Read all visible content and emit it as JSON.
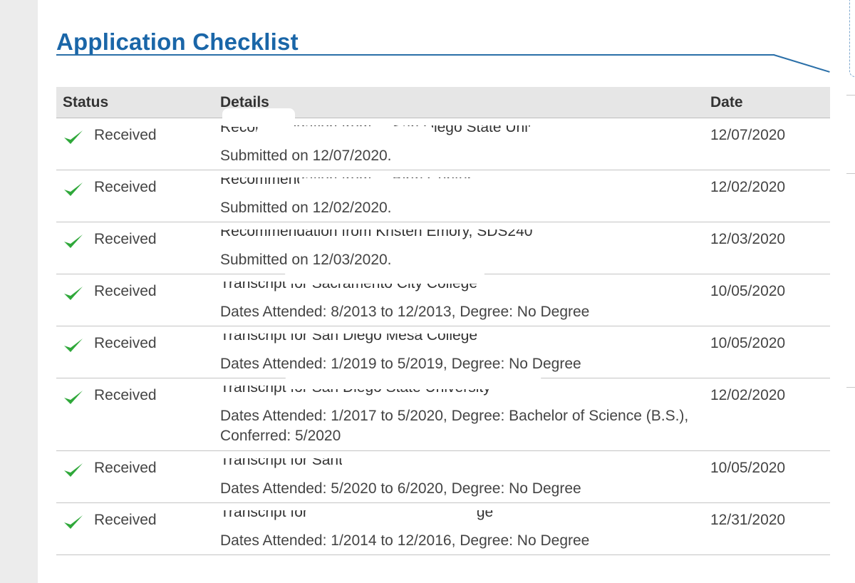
{
  "title": "Application Checklist",
  "columns": {
    "status": "Status",
    "details": "Details",
    "date": "Date"
  },
  "status_icon": "checkmark-icon",
  "accent_color": "#1a66a8",
  "check_color": "#2fa83a",
  "rows": [
    {
      "status": "Received",
      "title": "Recommendation from ... San Diego State University",
      "sub": "Submitted on 12/07/2020.",
      "date": "12/07/2020"
    },
    {
      "status": "Received",
      "title": "Recommendation from ... Birth Center",
      "sub": "Submitted on 12/02/2020.",
      "date": "12/02/2020"
    },
    {
      "status": "Received",
      "title": "Recommendation from Kristen Emory, SDS240",
      "sub": "Submitted on 12/03/2020.",
      "date": "12/03/2020"
    },
    {
      "status": "Received",
      "title": "Transcript for Sacramento City College",
      "sub": "Dates Attended: 8/2013 to 12/2013, Degree: No Degree",
      "date": "10/05/2020"
    },
    {
      "status": "Received",
      "title": "Transcript for San Diego Mesa College",
      "sub": "Dates Attended: 1/2019 to 5/2019, Degree: No Degree",
      "date": "10/05/2020"
    },
    {
      "status": "Received",
      "title": "Transcript for San Diego State University",
      "sub": "Dates Attended: 1/2017 to 5/2020, Degree: Bachelor of Science (B.S.), Conferred: 5/2020",
      "date": "12/02/2020"
    },
    {
      "status": "Received",
      "title": "Transcript for Santa Barbara City College",
      "sub": "Dates Attended: 5/2020 to 6/2020, Degree: No Degree",
      "date": "10/05/2020"
    },
    {
      "status": "Received",
      "title": "Transcript for Solano Community College",
      "sub": "Dates Attended: 1/2014 to 12/2016, Degree: No Degree",
      "date": "12/31/2020"
    }
  ]
}
